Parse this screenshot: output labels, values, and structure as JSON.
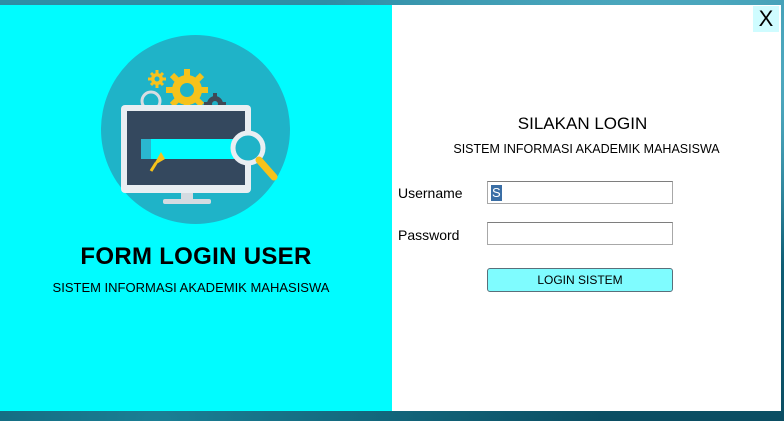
{
  "left_panel": {
    "title": "FORM LOGIN USER",
    "subtitle": "SISTEM INFORMASI AKADEMIK MAHASISWA",
    "illustration_icon": "monitor-gears-magnifier-icon"
  },
  "window": {
    "close_label": "X"
  },
  "login_form": {
    "heading": "SILAKAN LOGIN",
    "subheading": "SISTEM INFORMASI AKADEMIK MAHASISWA",
    "username_label": "Username",
    "username_value": "S",
    "password_label": "Password",
    "password_value": "",
    "login_button_label": "LOGIN SISTEM"
  },
  "colors": {
    "left_panel_bg": "#00fcff",
    "right_panel_bg": "#ffffff",
    "button_bg": "#7ffcff",
    "illustration_circle": "#1fb3c8",
    "gear_yellow": "#f6c21b"
  }
}
